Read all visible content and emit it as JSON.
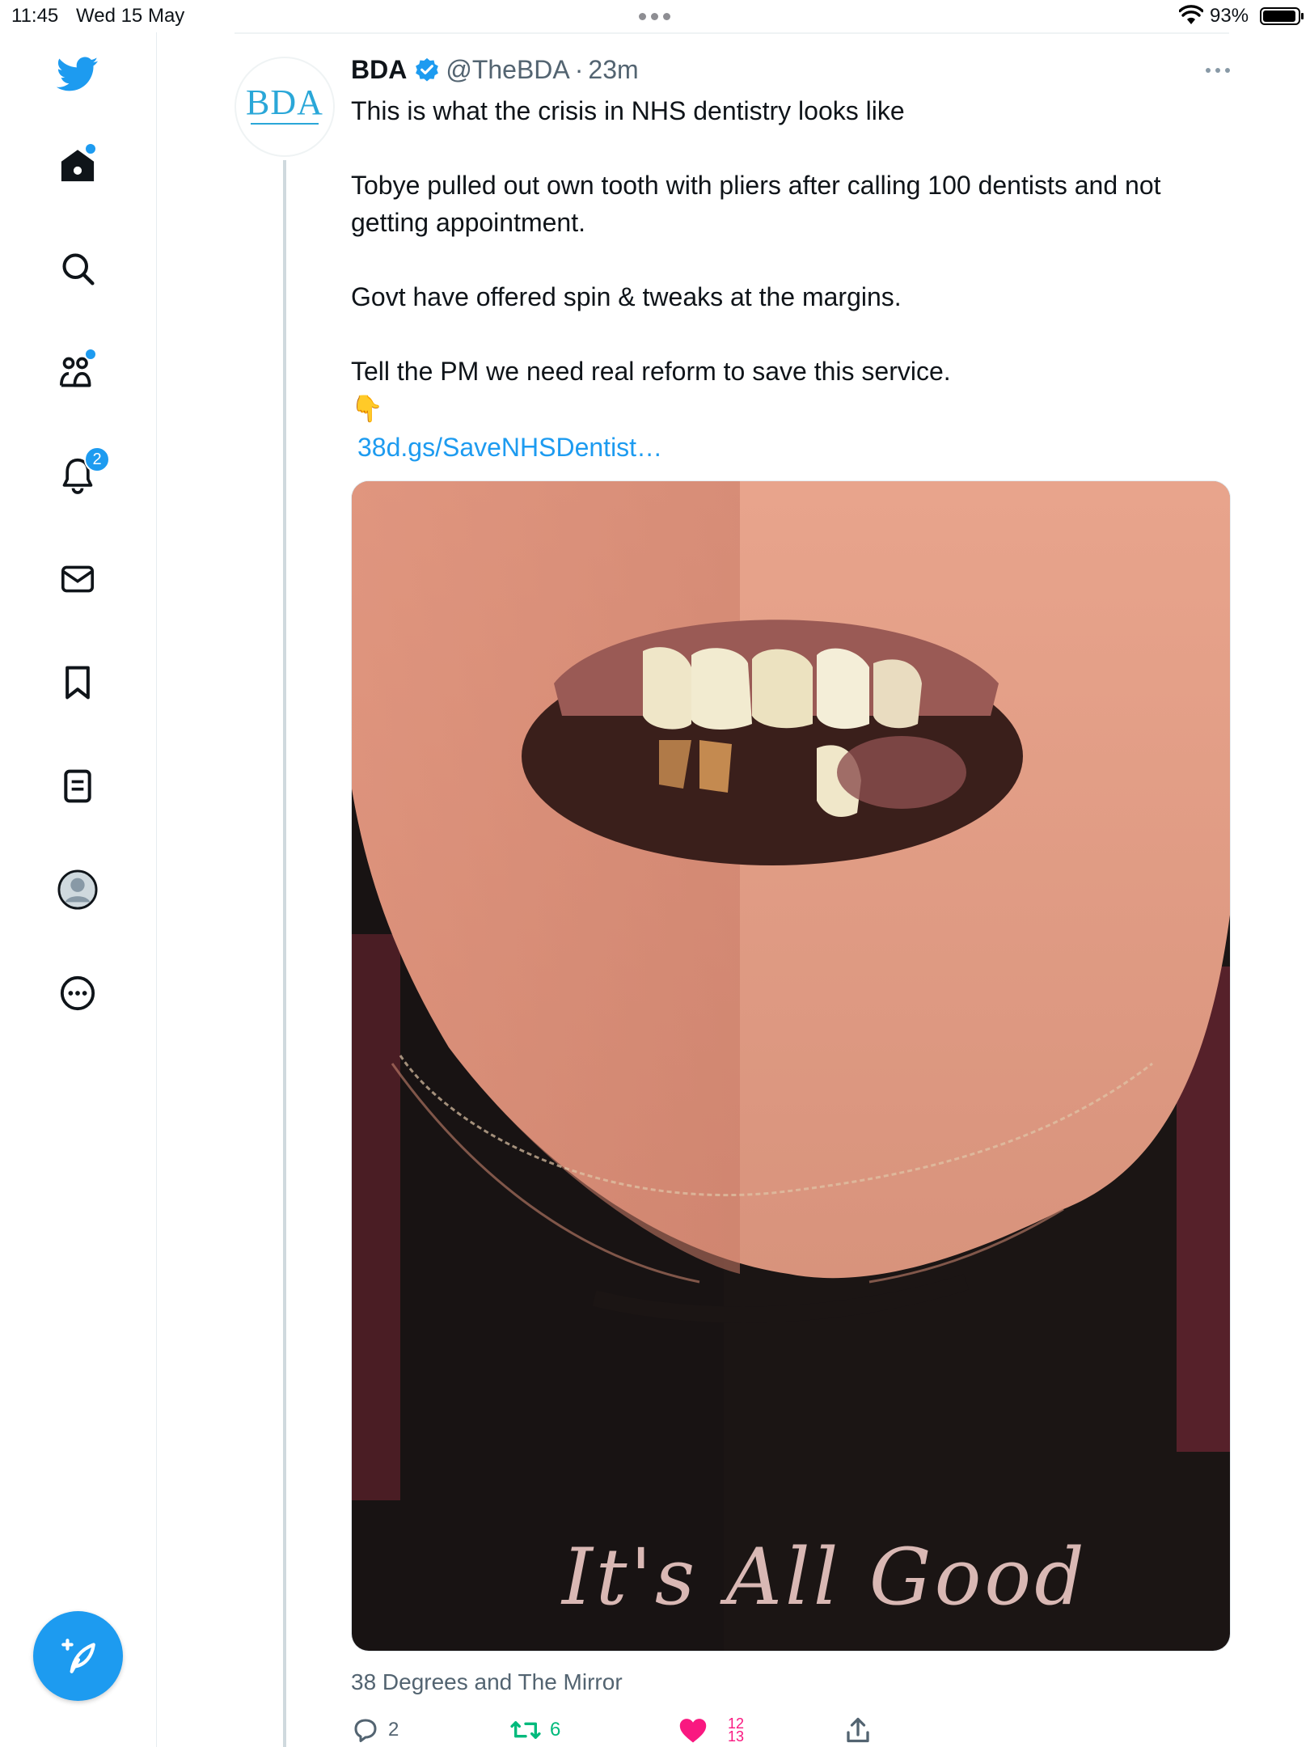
{
  "status_bar": {
    "time": "11:45",
    "date": "Wed 15 May",
    "battery": "93%"
  },
  "sidebar": {
    "items": [
      {
        "name": "home",
        "icon": "home-icon",
        "has_dot": true
      },
      {
        "name": "search",
        "icon": "search-icon",
        "has_dot": false
      },
      {
        "name": "communities",
        "icon": "communities-icon",
        "has_dot": true
      },
      {
        "name": "notifications",
        "icon": "bell-icon",
        "badge": "2"
      },
      {
        "name": "messages",
        "icon": "mail-icon"
      },
      {
        "name": "bookmarks",
        "icon": "bookmark-icon"
      },
      {
        "name": "lists",
        "icon": "list-icon"
      },
      {
        "name": "profile",
        "icon": "avatar-icon"
      },
      {
        "name": "more",
        "icon": "more-circle-icon"
      }
    ],
    "compose_icon": "compose-feather-icon"
  },
  "tweet": {
    "avatar_text": "BDA",
    "display_name": "BDA",
    "handle": "@TheBDA",
    "separator": "·",
    "time": "23m",
    "body": [
      "This is what the crisis in NHS dentistry looks like",
      "Tobye pulled out own tooth with pliers after calling 100 dentists and not getting appointment.",
      "Govt have offered spin & tweaks at the margins.",
      "Tell the PM we need real reform to save this service."
    ],
    "emoji": "👇",
    "link": "38d.gs/SaveNHSDentist…",
    "media_caption": "It's All Good",
    "media_source": "38 Degrees and The Mirror",
    "actions": {
      "replies": "2",
      "retweets": "6",
      "likes_top": "12",
      "likes_bottom": "13"
    }
  },
  "colors": {
    "accent": "#1d9bf0",
    "retweet": "#00ba7c",
    "like": "#f91880",
    "secondary_text": "#536471"
  }
}
